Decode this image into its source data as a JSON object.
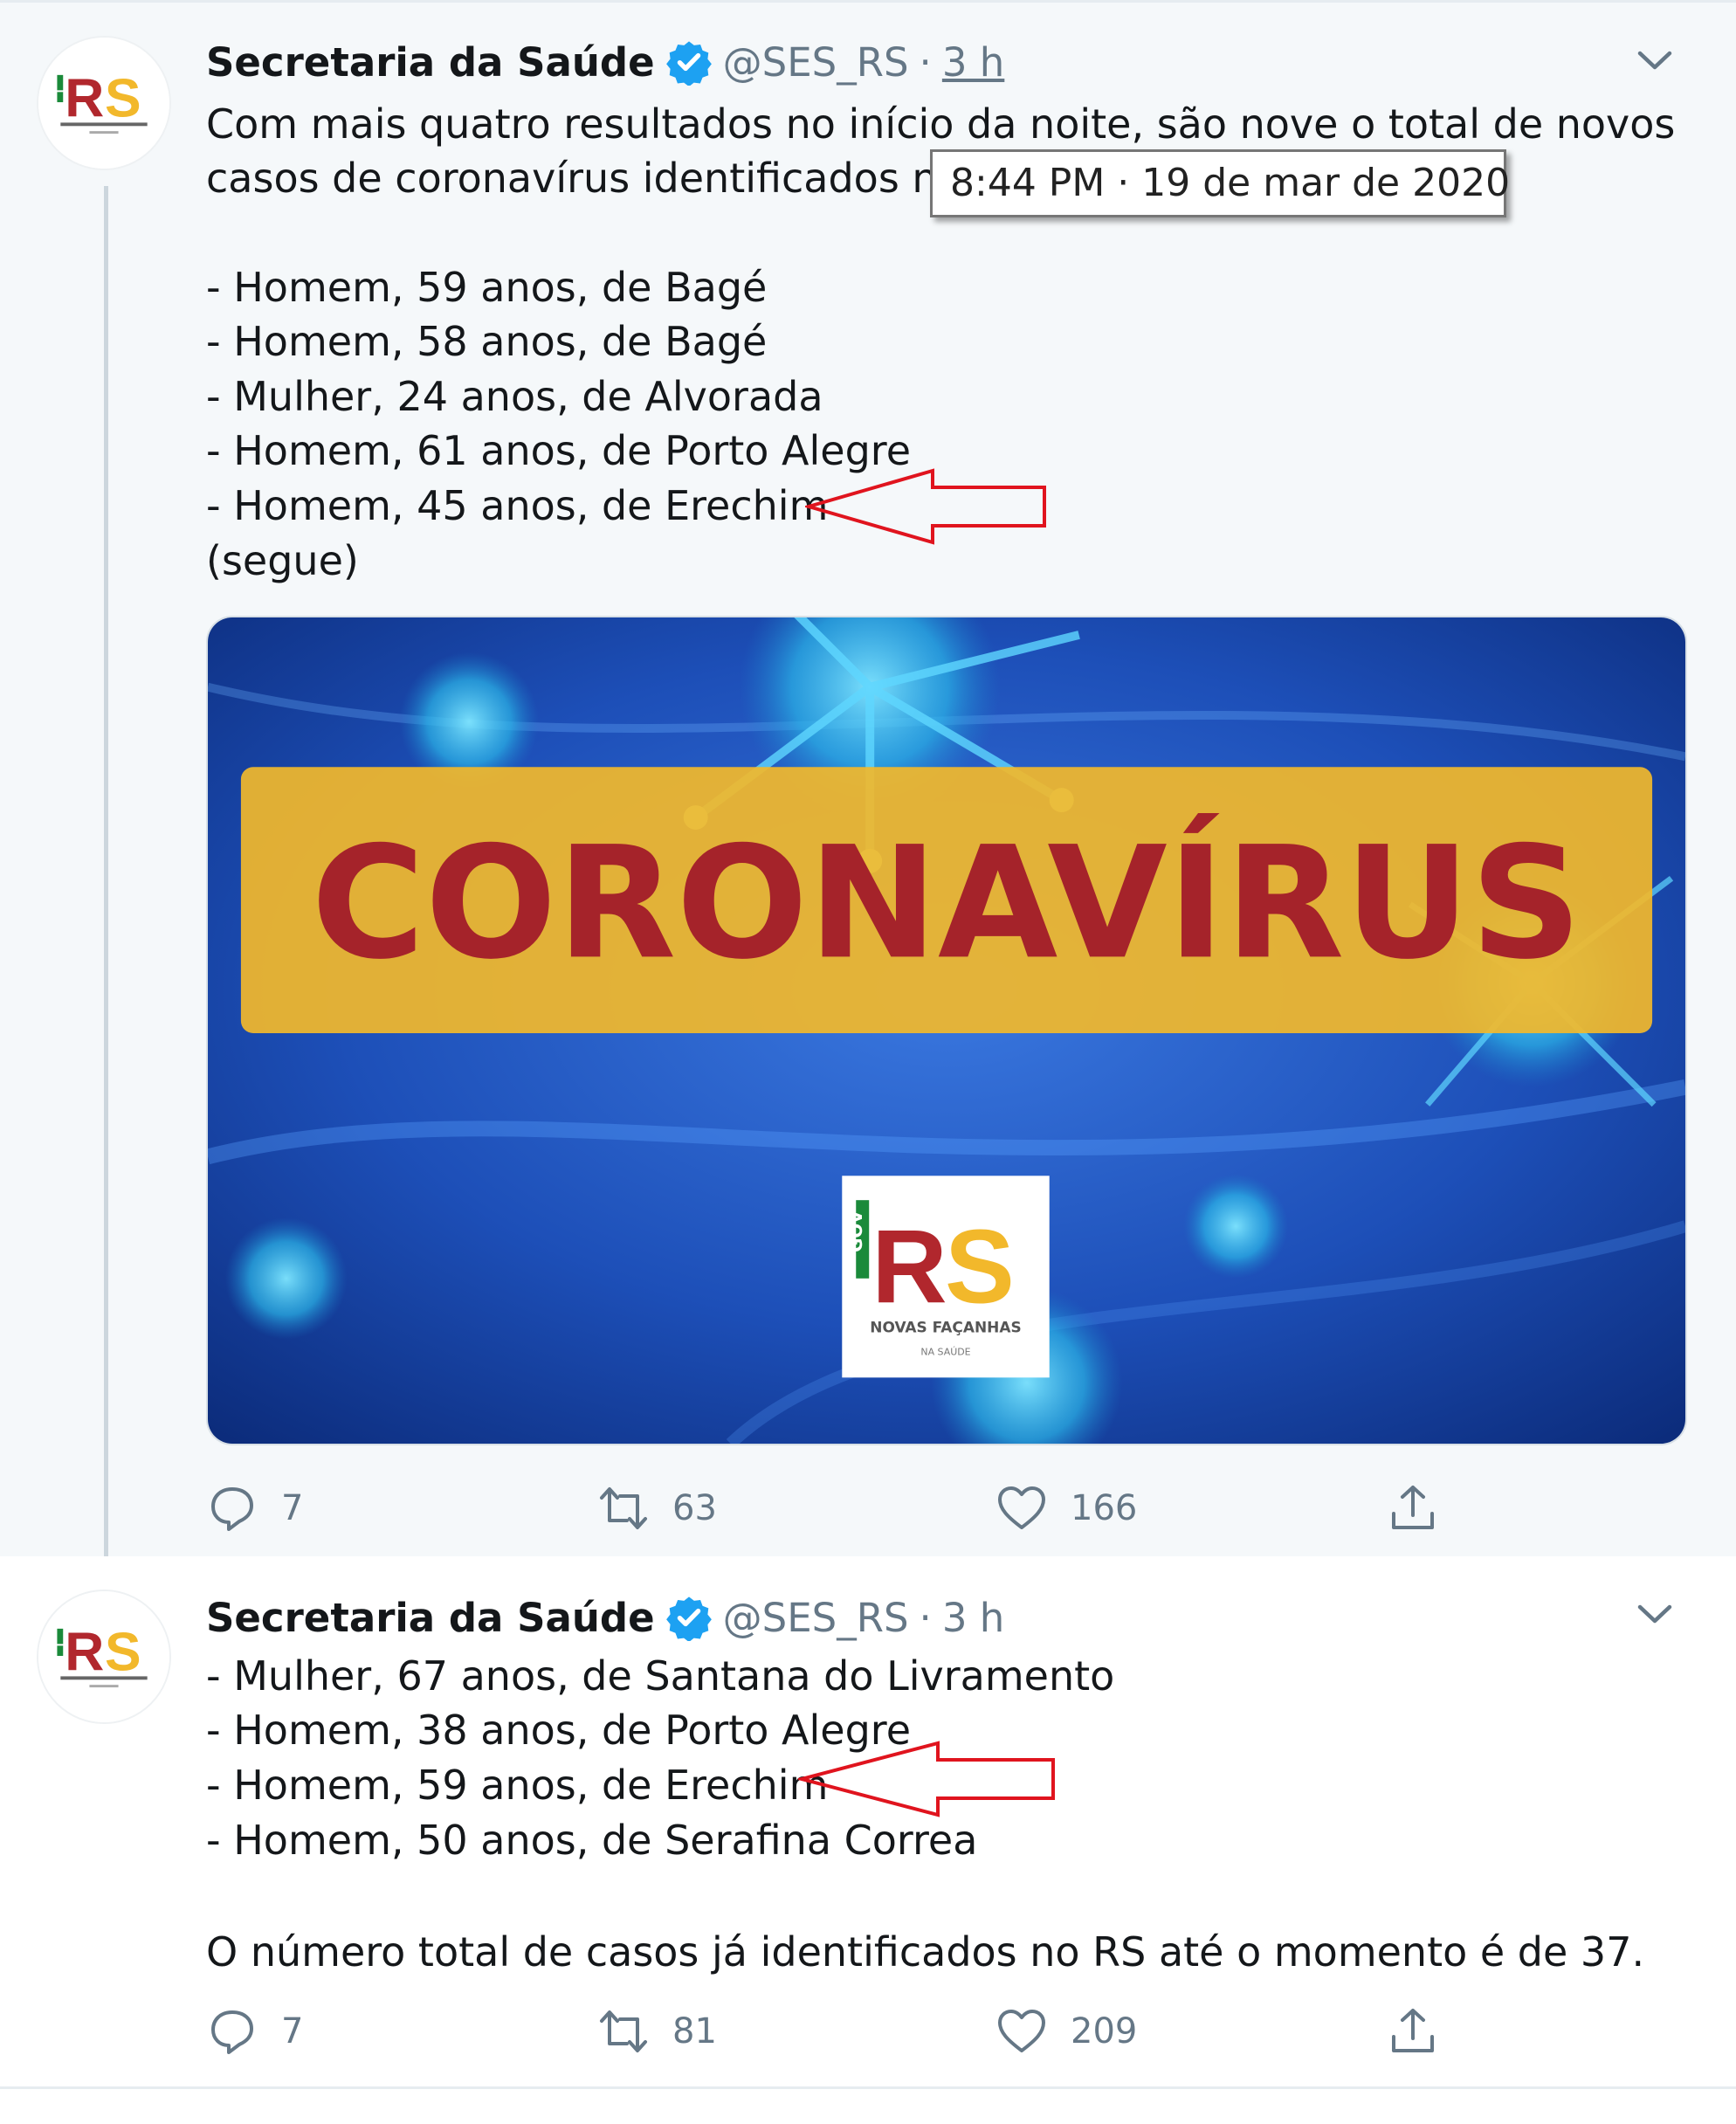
{
  "colors": {
    "accent": "#1da1f2",
    "muted": "#657786",
    "annotation_arrow": "#e0141e",
    "coronavirus_banner": "#f2b82b",
    "coronavirus_text": "#a5232a"
  },
  "tooltip": {
    "text": "8:44 PM · 19 de mar de 2020"
  },
  "tweets": [
    {
      "author": "Secretaria da Saúde",
      "handle": "@SES_RS",
      "separator": "·",
      "time": "3 h",
      "lines": [
        "Com mais quatro resultados no início da noite, são nove o total de novos",
        "casos de coronavírus identificados no",
        "",
        "- Homem, 59 anos, de Bagé",
        "- Homem, 58 anos, de Bagé",
        "- Mulher, 24 anos, de Alvorada",
        "- Homem, 61 anos, de Porto Alegre",
        "- Homem, 45 anos, de Erechim",
        "(segue)"
      ],
      "media": {
        "banner_text": "CORONAVÍRUS",
        "logo_letters": "RS",
        "logo_side": "GOV",
        "logo_caption": "NOVAS FAÇANHAS",
        "logo_subcaption": "NA SAÚDE"
      },
      "actions": {
        "replies": "7",
        "retweets": "63",
        "likes": "166"
      }
    },
    {
      "author": "Secretaria da Saúde",
      "handle": "@SES_RS",
      "separator": "·",
      "time": "3 h",
      "lines": [
        "- Mulher, 67 anos, de Santana do Livramento",
        "- Homem, 38 anos, de Porto Alegre",
        "- Homem, 59 anos, de Erechim",
        "- Homem, 50 anos, de Serafina Correa",
        "",
        "O número total de casos já identificados no RS até o momento é de 37."
      ],
      "actions": {
        "replies": "7",
        "retweets": "81",
        "likes": "209"
      }
    }
  ],
  "icons": {
    "verified": "verified-badge-icon",
    "caret": "chevron-down-icon",
    "reply": "reply-icon",
    "retweet": "retweet-icon",
    "like": "heart-icon",
    "share": "share-icon"
  }
}
